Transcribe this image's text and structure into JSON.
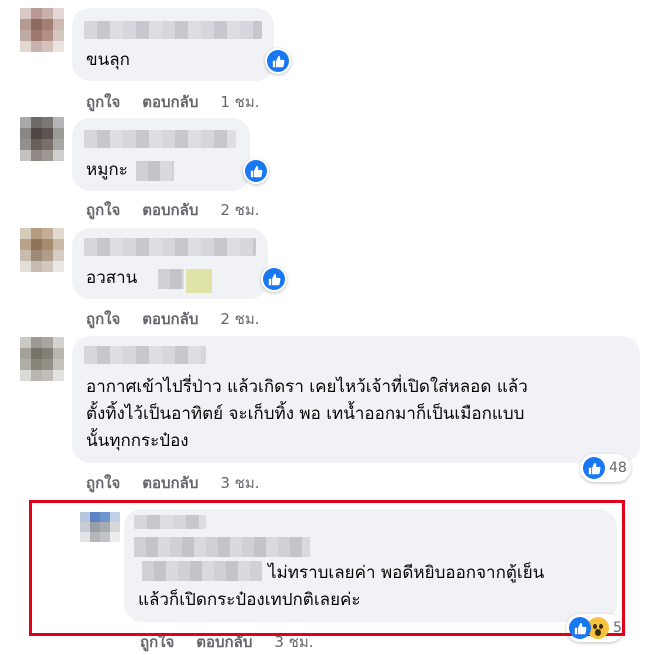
{
  "comments": [
    {
      "text_lines": [
        "ขนลุก"
      ],
      "like_label": "ถูกใจ",
      "reply_label": "ตอบกลับ",
      "time": "1 ชม."
    },
    {
      "text_lines": [
        "หมูกะ"
      ],
      "like_label": "ถูกใจ",
      "reply_label": "ตอบกลับ",
      "time": "2 ชม."
    },
    {
      "text_lines": [
        "อวสาน"
      ],
      "like_label": "ถูกใจ",
      "reply_label": "ตอบกลับ",
      "time": "2 ชม."
    },
    {
      "text_lines": [
        "อากาศเข้าไปรี่ป่าว แล้วเกิดรา เคยไหว้เจ้าที่เปิดใส่หลอด แล้ว",
        "ตั้งทิ้งไว้เป็นอาทิตย์ จะเก็บทิ้ง พอ เทน้ำออกมาก็เป็นเมือกแบบ",
        "นั้นทุกกระป๋อง"
      ],
      "like_label": "ถูกใจ",
      "reply_label": "ตอบกลับ",
      "time": "3 ชม.",
      "reaction_count": "48"
    },
    {
      "text_lines": [
        "ไม่ทราบเลยค่า พอดีหยิบออกจากตู้เย็น",
        "แล้วก็เปิดกระป๋องเทปกติเลยค่ะ"
      ],
      "like_label": "ถูกใจ",
      "reply_label": "ตอบกลับ",
      "time": "3 ชม.",
      "reaction_count": "5"
    }
  ],
  "icons": {
    "like": "thumbs-up-icon",
    "wow": "wow-face-icon"
  },
  "colors": {
    "accent": "#1877f2",
    "bubble": "#f0f2f5",
    "highlight": "#e0001a",
    "muted": "#65676b"
  }
}
